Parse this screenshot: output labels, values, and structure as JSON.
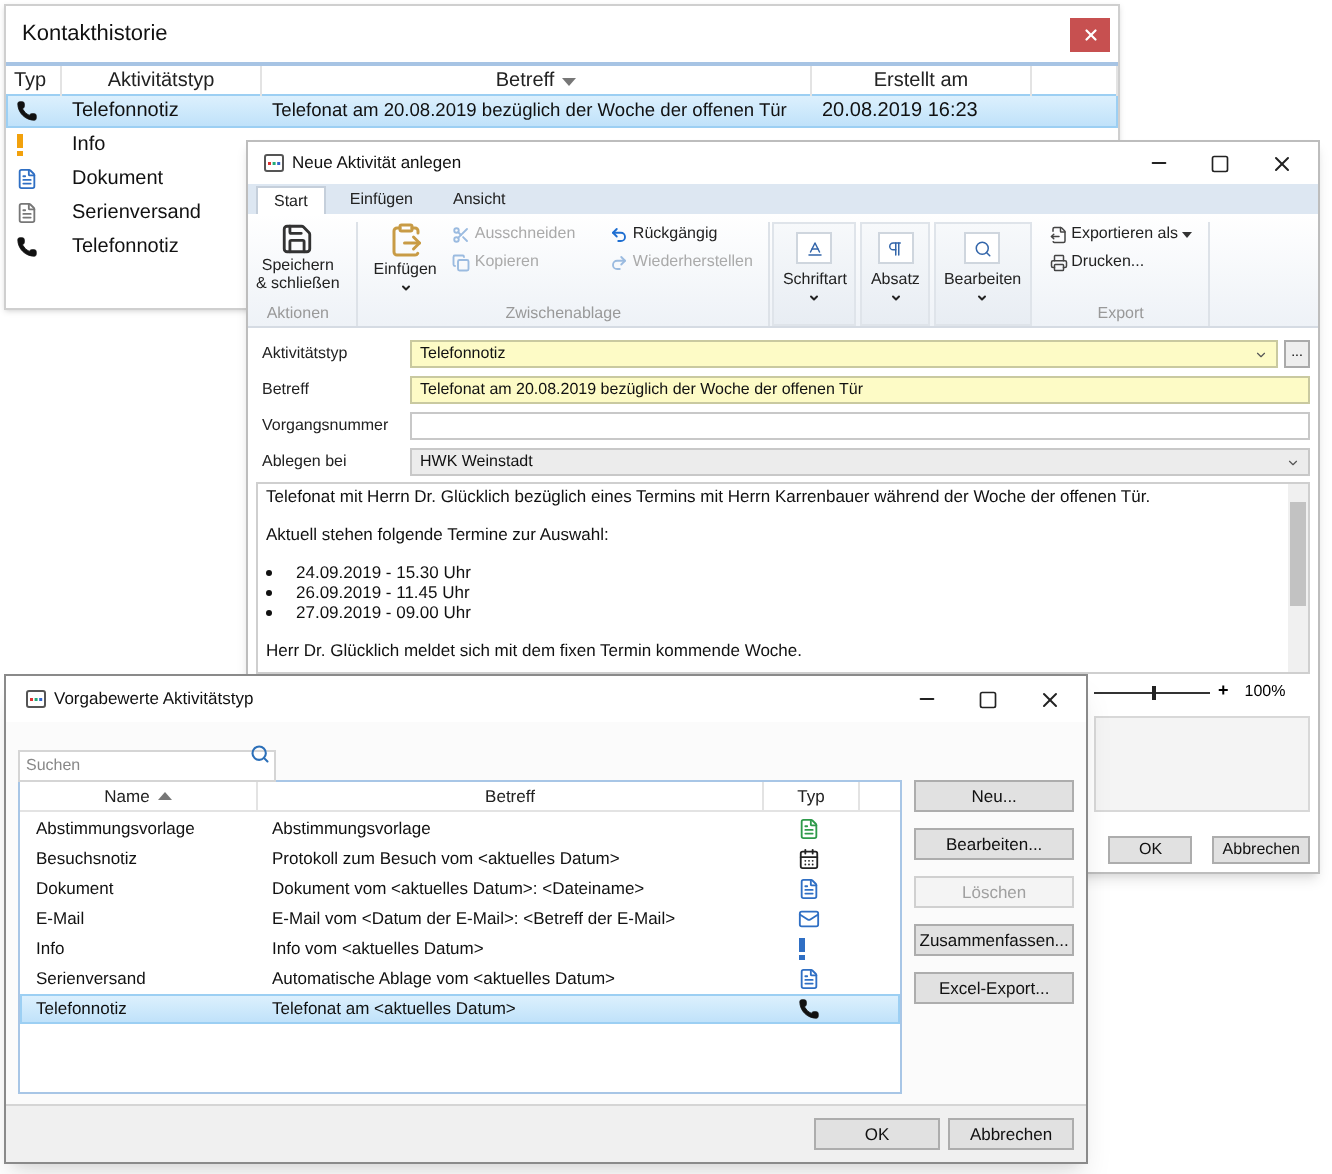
{
  "history_window": {
    "title": "Kontakthistorie",
    "columns": [
      {
        "label": "Typ",
        "sorted": false
      },
      {
        "label": "Aktivitätstyp",
        "sorted": false
      },
      {
        "label": "Betreff",
        "sorted": true
      },
      {
        "label": "Erstellt am",
        "sorted": false
      }
    ],
    "rows": [
      {
        "kind": "phone",
        "type": "Telefonnotiz",
        "subject": "Telefonat am 20.08.2019 bezüglich der Woche der offenen Tür",
        "created": "20.08.2019 16:23",
        "selected": true
      },
      {
        "kind": "info",
        "type": "Info",
        "selected": false
      },
      {
        "kind": "document",
        "type": "Dokument",
        "selected": false
      },
      {
        "kind": "series",
        "type": "Serienversand",
        "selected": false
      },
      {
        "kind": "phone",
        "type": "Telefonnotiz",
        "selected": false
      }
    ]
  },
  "activity_window": {
    "title": "Neue Aktivität anlegen",
    "tabs": [
      {
        "label": "Start",
        "selected": true
      },
      {
        "label": "Einfügen",
        "selected": false
      },
      {
        "label": "Ansicht",
        "selected": false
      }
    ],
    "ribbon": {
      "actions": {
        "label": "Aktionen",
        "save": [
          "Speichern",
          "& schließen"
        ]
      },
      "clipboard": {
        "label": "Zwischenablage",
        "paste": "Einfügen",
        "commands": [
          {
            "label": "Ausschneiden",
            "disabled": true
          },
          {
            "label": "Kopieren",
            "disabled": true
          },
          {
            "label": "Rückgängig",
            "disabled": false
          },
          {
            "label": "Wiederherstellen",
            "disabled": true
          }
        ]
      },
      "menus": [
        {
          "label": "Schriftart"
        },
        {
          "label": "Absatz"
        },
        {
          "label": "Bearbeiten"
        }
      ],
      "export": {
        "label": "Export",
        "commands": [
          {
            "label": "Exportieren als",
            "dropdown": true
          },
          {
            "label": "Drucken...",
            "dropdown": false
          }
        ]
      }
    },
    "fields": [
      {
        "label": "Aktivitätstyp",
        "kind": "combo",
        "value": "Telefonnotiz",
        "required": true,
        "button": "..."
      },
      {
        "label": "Betreff",
        "kind": "text",
        "value": "Telefonat am 20.08.2019 bezüglich der Woche der offenen Tür",
        "required": true
      },
      {
        "label": "Vorgangsnummer",
        "kind": "text",
        "required": false
      },
      {
        "label": "Ablegen bei",
        "kind": "select",
        "value": "HWK Weinstadt",
        "required": false
      }
    ],
    "note": [
      {
        "kind": "paragraph",
        "text": "Telefonat mit Herrn Dr. Glücklich bezüglich eines Termins mit Herrn Karrenbauer während der Woche der offenen Tür."
      },
      {
        "kind": "paragraph",
        "text": "Aktuell stehen folgende Termine zur Auswahl:"
      },
      {
        "kind": "bullets",
        "items": [
          "24.09.2019 - 15.30 Uhr",
          "26.09.2019 - 11.45 Uhr",
          "27.09.2019 - 09.00 Uhr"
        ]
      },
      {
        "kind": "paragraph",
        "text": "Herr Dr. Glücklich meldet sich mit dem fixen Termin kommende Woche."
      }
    ],
    "zoom": {
      "level": 0.5,
      "plus": "+",
      "reading": "100%"
    },
    "buttons": [
      "OK",
      "Abbrechen"
    ]
  },
  "defaults_window": {
    "title": "Vorgabewerte Aktivitätstyp",
    "search": {
      "placeholder": "Suchen"
    },
    "columns": [
      {
        "label": "Name",
        "sorted": true
      },
      {
        "label": "Betreff",
        "sorted": false
      },
      {
        "label": "Typ",
        "sorted": false
      }
    ],
    "rows": [
      {
        "name": "Abstimmungsvorlage",
        "subject": "Abstimmungsvorlage",
        "kind": "template",
        "selected": false
      },
      {
        "name": "Besuchsnotiz",
        "subject": "Protokoll zum Besuch vom <aktuelles Datum>",
        "kind": "visit",
        "selected": false
      },
      {
        "name": "Dokument",
        "subject": "Dokument vom <aktuelles Datum>: <Dateiname>",
        "kind": "document",
        "selected": false
      },
      {
        "name": "E-Mail",
        "subject": "E-Mail vom <Datum der E-Mail>: <Betreff der E-Mail>",
        "kind": "email",
        "selected": false
      },
      {
        "name": "Info",
        "subject": "Info vom <aktuelles Datum>",
        "kind": "info",
        "selected": false
      },
      {
        "name": "Serienversand",
        "subject": "Automatische Ablage vom <aktuelles Datum>",
        "kind": "document",
        "selected": false
      },
      {
        "name": "Telefonnotiz",
        "subject": "Telefonat am <aktuelles Datum>",
        "kind": "phone",
        "selected": true
      }
    ],
    "actions": [
      {
        "label": "Neu...",
        "disabled": false
      },
      {
        "label": "Bearbeiten...",
        "disabled": false
      },
      {
        "label": "Löschen",
        "disabled": true
      },
      {
        "label": "Zusammenfassen...",
        "disabled": false
      },
      {
        "label": "Excel-Export...",
        "disabled": false
      }
    ],
    "buttons": [
      "OK",
      "Abbrechen"
    ]
  }
}
